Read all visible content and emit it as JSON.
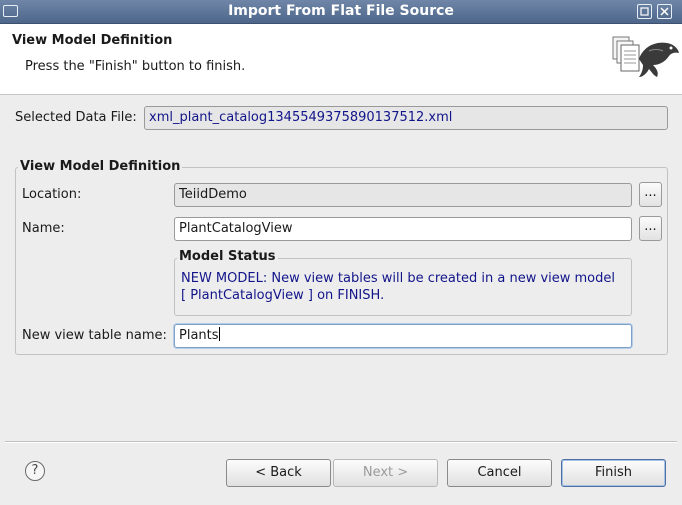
{
  "window": {
    "title": "Import From Flat File Source"
  },
  "header": {
    "title": "View Model Definition",
    "message": "Press the \"Finish\" button to finish."
  },
  "selected_file": {
    "label": "Selected Data File:",
    "value": "xml_plant_catalog1345549375890137512.xml"
  },
  "group": {
    "title": "View Model Definition",
    "location": {
      "label": "Location:",
      "value": "TeiidDemo",
      "browse": "..."
    },
    "name": {
      "label": "Name:",
      "value": "PlantCatalogView",
      "browse": "..."
    },
    "model_status": {
      "title": "Model Status",
      "line1": "NEW MODEL: New view tables will be created in a new view model",
      "line2": "[ PlantCatalogView ] on FINISH."
    },
    "new_table": {
      "label": "New view table name:",
      "value": "Plants"
    }
  },
  "buttons": {
    "help": "?",
    "back": "< Back",
    "next": "Next >",
    "cancel": "Cancel",
    "finish": "Finish"
  },
  "icons": {
    "window_menu": "window-menu-icon",
    "maximize": "maximize-icon",
    "close": "close-icon",
    "wizard": "teiid-wizard-icon",
    "help": "help-icon"
  }
}
